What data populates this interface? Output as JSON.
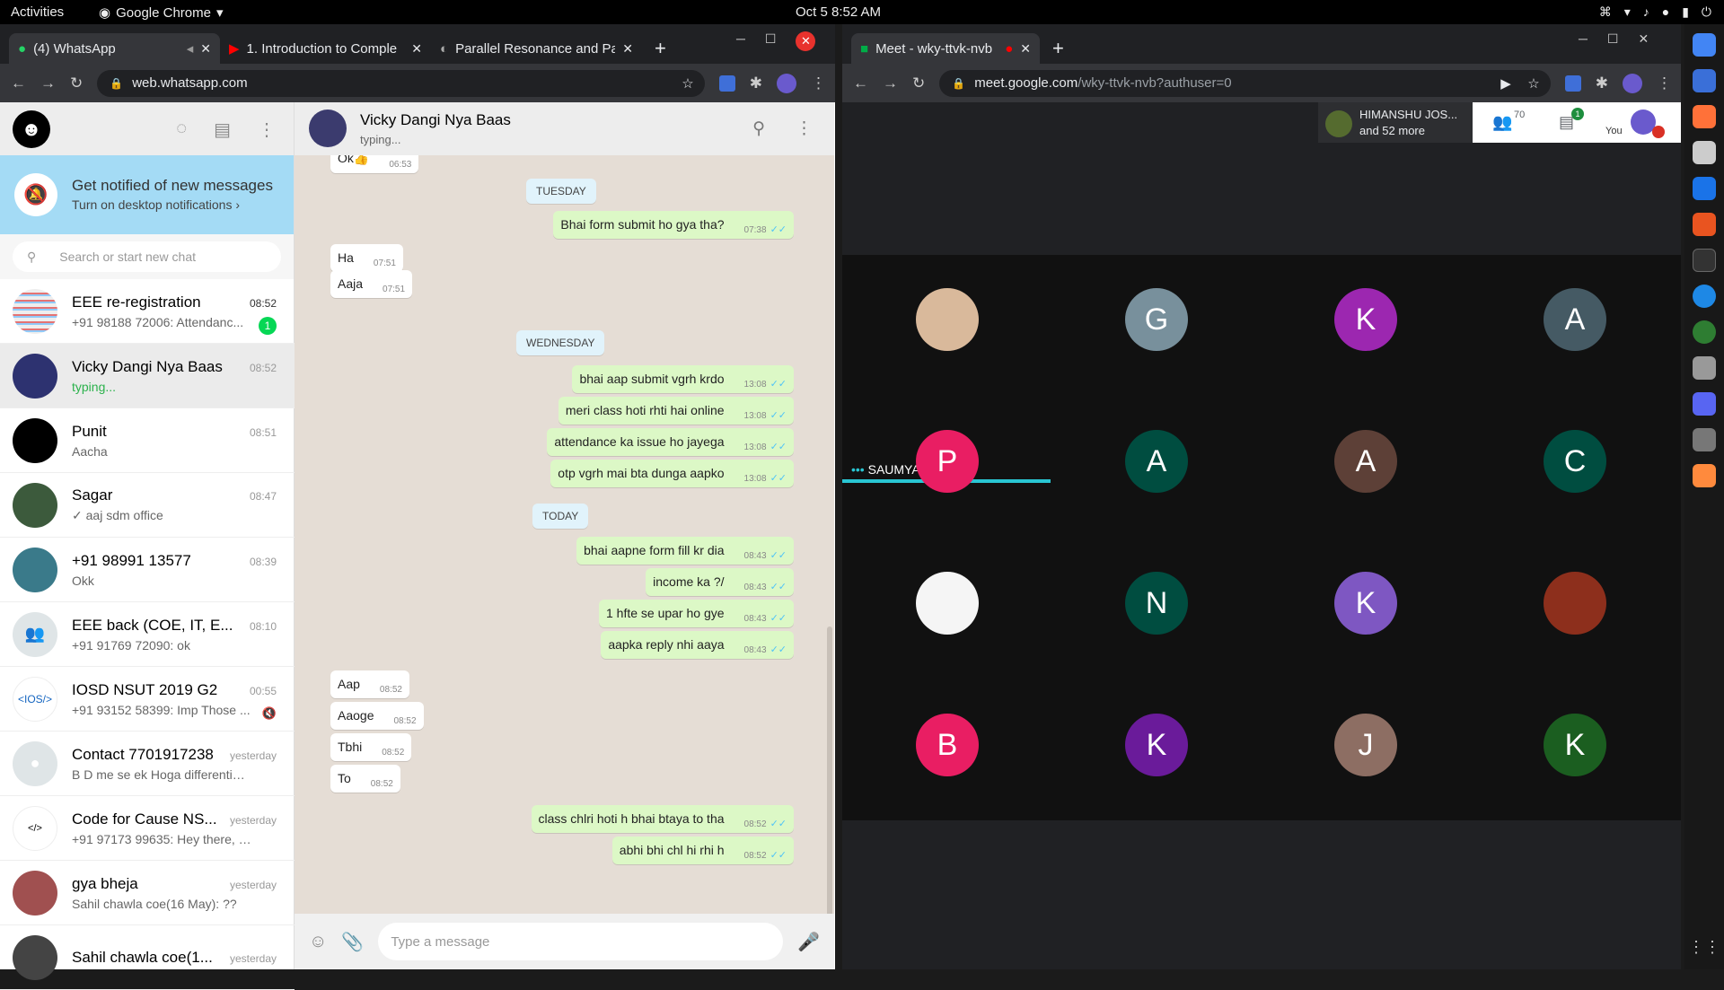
{
  "topbar": {
    "activities": "Activities",
    "app": "Google Chrome",
    "clock": "Oct 5  8:52 AM"
  },
  "left_window": {
    "tabs": [
      {
        "title": "(4) WhatsApp"
      },
      {
        "title": "1. Introduction to Comple"
      },
      {
        "title": "Parallel Resonance and Pa"
      }
    ],
    "url": "web.whatsapp.com"
  },
  "right_window": {
    "tabs": [
      {
        "title": "Meet - wky-ttvk-nvb"
      }
    ],
    "url_main": "meet.google.com",
    "url_rest": "/wky-ttvk-nvb?authuser=0"
  },
  "wa": {
    "notif_title": "Get notified of new messages",
    "notif_sub": "Turn on desktop notifications ›",
    "search_placeholder": "Search or start new chat",
    "chats": [
      {
        "name": "EEE re-registration",
        "time": "08:52",
        "msg": "+91 98188 72006: Attendanc...",
        "badge": "1"
      },
      {
        "name": "Vicky Dangi Nya Baas",
        "time": "08:52",
        "msg": "typing..."
      },
      {
        "name": "Punit",
        "time": "08:51",
        "msg": "Aacha"
      },
      {
        "name": "Sagar",
        "time": "08:47",
        "msg": "✓ aaj sdm office"
      },
      {
        "name": "+91 98991 13577",
        "time": "08:39",
        "msg": "Okk"
      },
      {
        "name": "EEE back (COE, IT, E...",
        "time": "08:10",
        "msg": "+91 91769 72090: ok"
      },
      {
        "name": "IOSD NSUT 2019 G2",
        "time": "00:55",
        "msg": "+91 93152 58399: Imp Those ..."
      },
      {
        "name": "Contact 7701917238",
        "time": "yesterday",
        "msg": "B D me se ek Hoga differentiate ..."
      },
      {
        "name": "Code for Cause NS...",
        "time": "yesterday",
        "msg": "+91 97173 99635: Hey there, ha..."
      },
      {
        "name": "gya bheja",
        "time": "yesterday",
        "msg": "Sahil chawla coe(16 May): ??"
      },
      {
        "name": "Sahil chawla coe(1...",
        "time": "yesterday",
        "msg": ""
      }
    ],
    "header_name": "Vicky Dangi Nya Baas",
    "header_status": "typing...",
    "days": {
      "tuesday": "TUESDAY",
      "wednesday": "WEDNESDAY",
      "today": "TODAY"
    },
    "messages": [
      {
        "text": "Ok👍",
        "time": "06:53"
      },
      {
        "text": "Bhai form submit ho gya tha?",
        "time": "07:38"
      },
      {
        "text": "Ha",
        "time": "07:51"
      },
      {
        "text": "Aaja",
        "time": "07:51"
      },
      {
        "text": "bhai aap submit vgrh krdo",
        "time": "13:08"
      },
      {
        "text": "meri class hoti rhti hai online",
        "time": "13:08"
      },
      {
        "text": "attendance ka issue ho jayega",
        "time": "13:08"
      },
      {
        "text": "otp vgrh mai bta dunga aapko",
        "time": "13:08"
      },
      {
        "text": "bhai aapne form fill kr dia",
        "time": "08:43"
      },
      {
        "text": "income ka ?/",
        "time": "08:43"
      },
      {
        "text": "1 hfte se upar ho gye",
        "time": "08:43"
      },
      {
        "text": "aapka reply nhi aaya",
        "time": "08:43"
      },
      {
        "text": "Aap",
        "time": "08:52"
      },
      {
        "text": "Aaoge",
        "time": "08:52"
      },
      {
        "text": "Tbhi",
        "time": "08:52"
      },
      {
        "text": "To",
        "time": "08:52"
      },
      {
        "text": "class chlri hoti h bhai btaya to tha",
        "time": "08:52"
      },
      {
        "text": "abhi bhi chl hi rhi h",
        "time": "08:52"
      }
    ],
    "composer_placeholder": "Type a message"
  },
  "meet": {
    "participant_name": "HIMANSHU JOS...",
    "participant_more": "and 52 more",
    "people_count": "70",
    "chat_badge": "1",
    "you_label": "You",
    "speaker": "SAUMYA SINGH",
    "tiles": [
      {
        "letter": "",
        "color": "#d9b99b"
      },
      {
        "letter": "G",
        "color": "#78909c"
      },
      {
        "letter": "K",
        "color": "#9c27b0"
      },
      {
        "letter": "A",
        "color": "#455a64"
      },
      {
        "letter": "P",
        "color": "#e91e63"
      },
      {
        "letter": "A",
        "color": "#004d40"
      },
      {
        "letter": "A",
        "color": "#5d4037"
      },
      {
        "letter": "C",
        "color": "#004d40"
      },
      {
        "letter": "",
        "color": "#f5f5f5"
      },
      {
        "letter": "N",
        "color": "#004d40"
      },
      {
        "letter": "K",
        "color": "#7e57c2"
      },
      {
        "letter": "",
        "color": "#8d2f1c"
      },
      {
        "letter": "B",
        "color": "#e91e63"
      },
      {
        "letter": "K",
        "color": "#6a1b9a"
      },
      {
        "letter": "J",
        "color": "#8d6e63"
      },
      {
        "letter": "K",
        "color": "#1b5e20"
      }
    ]
  }
}
